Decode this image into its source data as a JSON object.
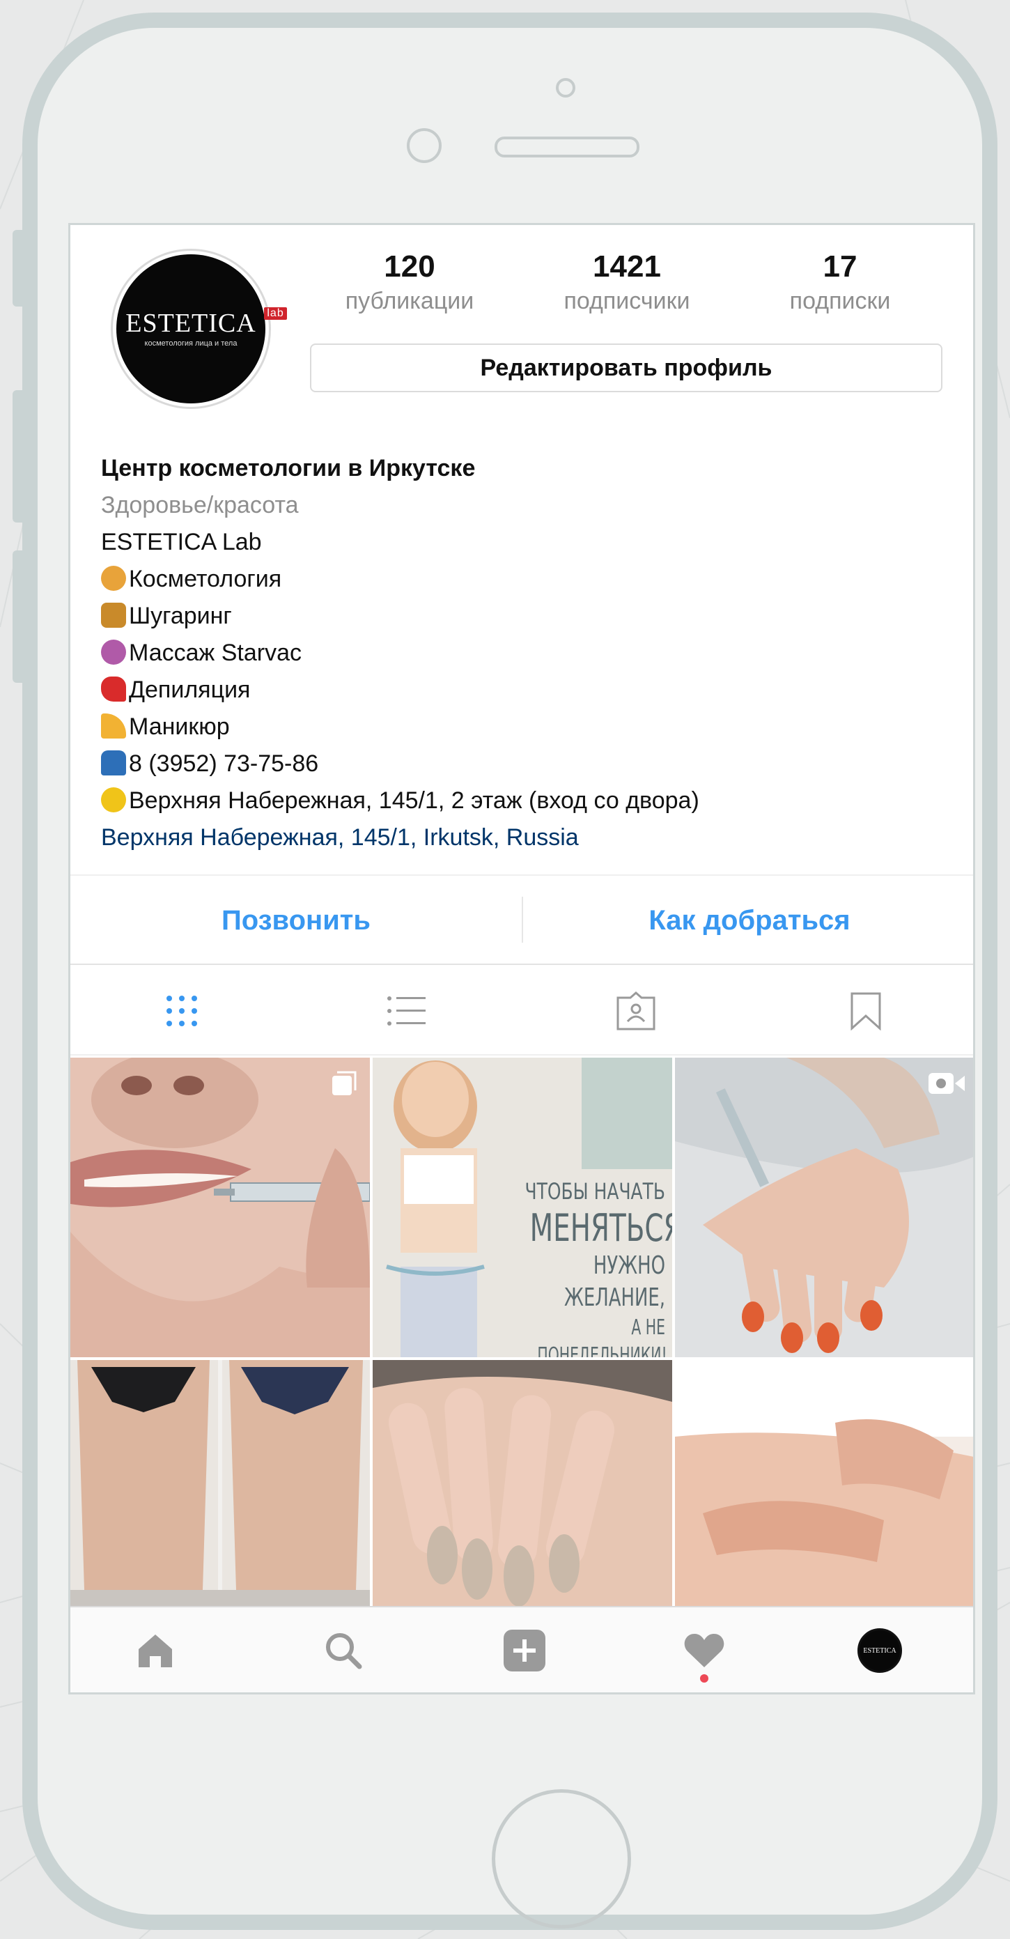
{
  "profile": {
    "posts_count": "120",
    "posts_label": "публикации",
    "followers_count": "1421",
    "followers_label": "подписчики",
    "following_count": "17",
    "following_label": "подписки",
    "edit_button": "Редактировать профиль",
    "avatar_logo": "ESTETICA",
    "avatar_logo_badge": "lab",
    "avatar_logo_sub": "косметология лица и тела"
  },
  "bio": {
    "name": "Центр косметологии в Иркутске",
    "category": "Здоровье/красота",
    "lines": [
      {
        "text": "ESTETICA Lab",
        "emoji": ""
      },
      {
        "text": "Косметология",
        "emoji": "woman-emoji",
        "emoji_color": "#e8a33a"
      },
      {
        "text": "Шугаринг",
        "emoji": "honey-pot-emoji",
        "emoji_color": "#c98a2a"
      },
      {
        "text": "Массаж Starvac",
        "emoji": "massage-emoji",
        "emoji_color": "#b05aa8"
      },
      {
        "text": "Депиляция",
        "emoji": "dancer-emoji",
        "emoji_color": "#d92b2b"
      },
      {
        "text": "Маникюр",
        "emoji": "nail-polish-emoji",
        "emoji_color": "#f2b233"
      },
      {
        "text": "8 (3952) 73-75-86",
        "emoji": "phone-emoji",
        "emoji_color": "#2d6fb8"
      },
      {
        "text": "Верхняя Набережная, 145/1, 2 этаж (вход со двора)",
        "emoji": "pushpin-emoji",
        "emoji_color": "#f0c419"
      }
    ],
    "location": "Верхняя Набережная, 145/1, Irkutsk, Russia"
  },
  "actions": {
    "call": "Позвонить",
    "directions": "Как добраться"
  },
  "tabs": [
    "grid-icon",
    "list-icon",
    "tagged-icon",
    "saved-icon"
  ],
  "posts": [
    {
      "subject": "lip filler injection",
      "badge": "multiple-photos-icon",
      "text_lines": []
    },
    {
      "subject": "fitness motivation woman",
      "badge": "",
      "text_lines": [
        "ЧТОБЫ НАЧАТЬ",
        "МЕНЯТЬСЯ,",
        "НУЖНО ЖЕЛАНИЕ,",
        "А НЕ ПОНЕДЕЛЬНИКИ!"
      ]
    },
    {
      "subject": "hand injection with red nails",
      "badge": "video-icon",
      "text_lines": []
    },
    {
      "subject": "before and after body",
      "badge": "",
      "text_lines": []
    },
    {
      "subject": "beige manicure",
      "badge": "",
      "text_lines": []
    },
    {
      "subject": "back massage",
      "badge": "",
      "text_lines": []
    }
  ],
  "bottom_nav": [
    "home-icon",
    "search-icon",
    "add-post-icon",
    "activity-heart-icon",
    "profile-avatar"
  ],
  "colors": {
    "accent_blue": "#3897f0",
    "location_link": "#003569",
    "secondary_text": "#8e8e8e",
    "notification": "#ed4956"
  }
}
